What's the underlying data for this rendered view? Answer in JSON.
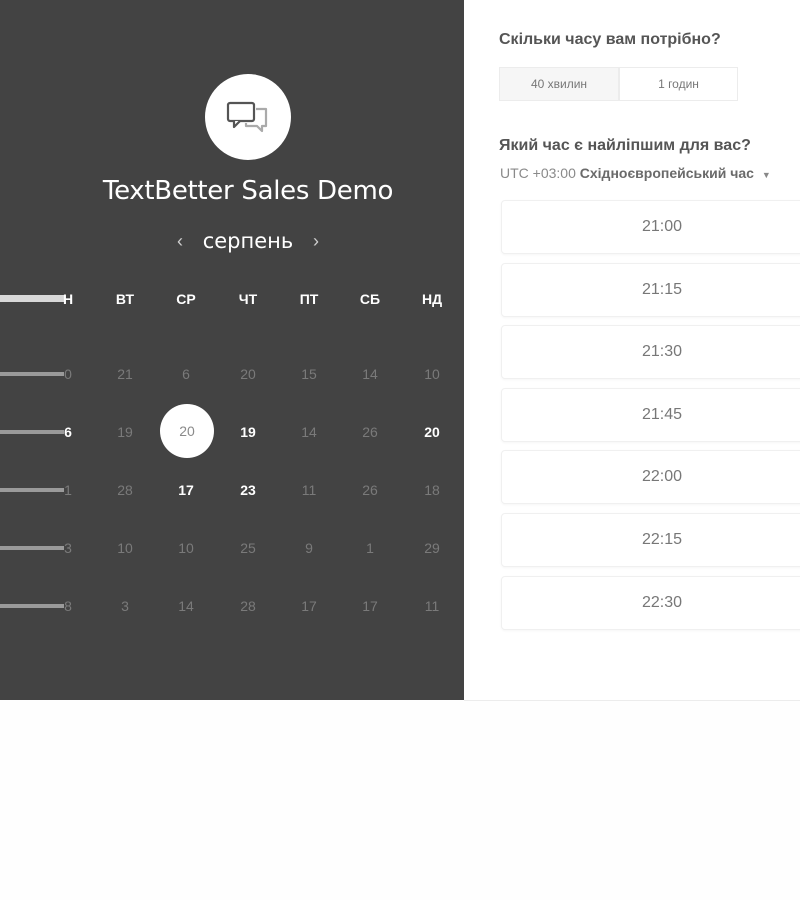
{
  "app_title": "TextBetter Sales Demo",
  "calendar": {
    "month": "серпень",
    "prev_symbol": "‹",
    "next_symbol": "›",
    "weekdays": [
      "Н",
      "ВТ",
      "СР",
      "ЧТ",
      "ПТ",
      "СБ",
      "НД"
    ],
    "rows": [
      [
        "0",
        "21",
        "6",
        "20",
        "15",
        "14",
        "10"
      ],
      [
        "6",
        "19",
        "20",
        "19",
        "14",
        "26",
        "20"
      ],
      [
        "1",
        "28",
        "17",
        "23",
        "11",
        "26",
        "18"
      ],
      [
        "3",
        "10",
        "10",
        "25",
        "9",
        "1",
        "29"
      ],
      [
        "8",
        "3",
        "14",
        "28",
        "17",
        "17",
        "11"
      ]
    ],
    "selected_day": "20"
  },
  "duration": {
    "question": "Скільки часу вам потрібно?",
    "options": [
      "40 хвилин",
      "1 годин"
    ],
    "selected": "40 хвилин"
  },
  "time": {
    "question": "Який час є найліпшим для вас?",
    "timezone_offset": "UTC +03:00",
    "timezone_name": "Східноєвропейський час",
    "slots": [
      "21:00",
      "21:15",
      "21:30",
      "21:45",
      "22:00",
      "22:15",
      "22:30"
    ]
  },
  "icons": {
    "logo": "chat-bubbles-icon",
    "prev": "chevron-left-icon",
    "next": "chevron-right-icon",
    "tz_dropdown": "caret-down-icon"
  },
  "colors": {
    "panel": "#434343",
    "page": "#fefefe",
    "available_day": "#ffffff",
    "unavailable_day": "#7a7a7a"
  }
}
